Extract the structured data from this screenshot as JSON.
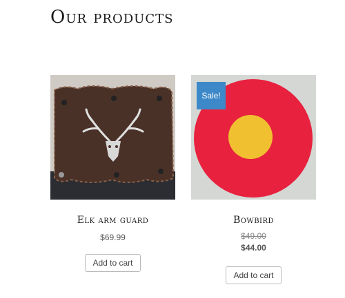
{
  "page": {
    "title": "Our products"
  },
  "products": [
    {
      "name": "Elk arm guard",
      "price": "$69.99",
      "button_label": "Add to cart",
      "image_icon": "elk-skull-arm-guard-image"
    },
    {
      "name": "Bowbird",
      "sale_badge": "Sale!",
      "price_old": "$49.00",
      "price_new": "$44.00",
      "button_label": "Add to cart",
      "image_icon": "red-yellow-target-image"
    }
  ],
  "colors": {
    "sale_badge": "#3d88c8",
    "target_red": "#e8213f",
    "target_yellow": "#f0c030"
  }
}
